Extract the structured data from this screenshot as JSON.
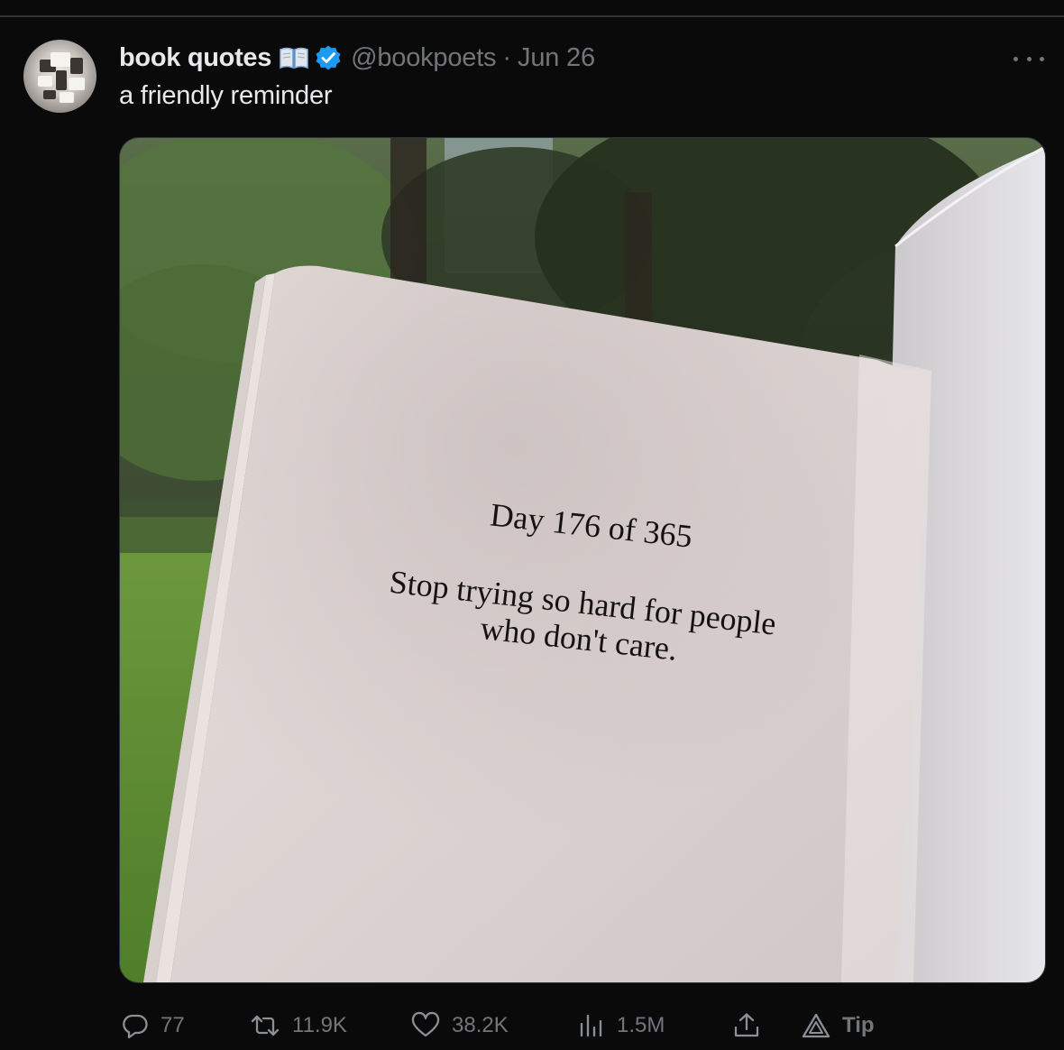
{
  "tweet": {
    "display_name": "book quotes",
    "handle": "@bookpoets",
    "separator": "·",
    "date": "Jun 26",
    "text": "a friendly reminder",
    "verified": true
  },
  "media": {
    "page_heading": "Day 176 of 365",
    "quote_line_1": "Stop trying so hard for people",
    "quote_line_2": "who don't care."
  },
  "actions": {
    "replies": "77",
    "reposts": "11.9K",
    "likes": "38.2K",
    "views": "1.5M",
    "tip_label": "Tip"
  },
  "colors": {
    "background": "#0a0a0b",
    "text_primary": "#e7e9ea",
    "text_secondary": "#71767b",
    "verified_blue": "#1d9bf0"
  },
  "icons": [
    "book-emoji-icon",
    "verified-badge-icon",
    "more-icon",
    "reply-icon",
    "repost-icon",
    "like-icon",
    "views-icon",
    "share-icon",
    "tip-icon"
  ]
}
